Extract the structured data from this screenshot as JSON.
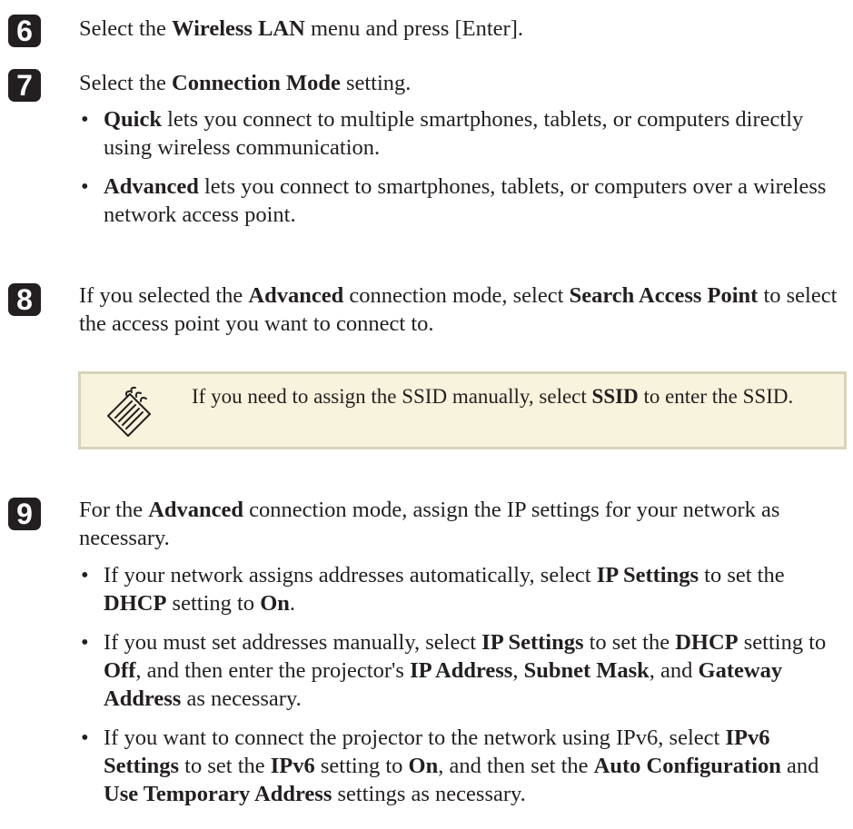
{
  "step6": {
    "number": "6",
    "pre": "Select the ",
    "b1": "Wireless LAN",
    "post": " menu and press [Enter]."
  },
  "step7": {
    "number": "7",
    "pre": "Select the ",
    "b1": "Connection Mode",
    "post": " setting.",
    "bullets": [
      {
        "bold": "Quick",
        "text": " lets you connect to multiple smartphones, tablets, or computers directly using wireless communication."
      },
      {
        "bold": "Advanced",
        "text": " lets you connect to smartphones, tablets, or computers over a wireless network access point."
      }
    ]
  },
  "step8": {
    "number": "8",
    "t1": "If you selected the ",
    "b1": "Advanced",
    "t2": " connection mode, select ",
    "b2": "Search Access Point",
    "t3": " to select the access point you want to connect to."
  },
  "note": {
    "icon": "note-pad-pencil-icon",
    "t1": "If you need to assign the SSID manually, select ",
    "b1": "SSID",
    "t2": " to enter the SSID."
  },
  "step9": {
    "number": "9",
    "t1": "For the ",
    "b1": "Advanced",
    "t2": " connection mode, assign the IP settings for your network as necessary.",
    "bullet1": {
      "t1": "If your network assigns addresses automatically, select ",
      "b1": "IP Settings",
      "t2": " to set the ",
      "b2": "DHCP",
      "t3": " setting to ",
      "b3": "On",
      "t4": "."
    },
    "bullet2": {
      "t1": "If you must set addresses manually, select ",
      "b1": "IP Settings",
      "t2": " to set the ",
      "b2": "DHCP",
      "t3": " setting to ",
      "b3": "Off",
      "t4": ", and then enter the projector's ",
      "b4": "IP Address",
      "t5": ", ",
      "b5": "Subnet Mask",
      "t6": ", and ",
      "b6": "Gateway Address",
      "t7": " as necessary."
    },
    "bullet3": {
      "t1": "If you want to connect the projector to the network using IPv6, select ",
      "b1": "IPv6 Settings",
      "t2": " to set the ",
      "b2": "IPv6",
      "t3": " setting to ",
      "b3": "On",
      "t4": ", and then set the ",
      "b4": "Auto Configuration",
      "t5": " and ",
      "b5": "Use Temporary Address",
      "t6": " settings as necessary."
    }
  }
}
